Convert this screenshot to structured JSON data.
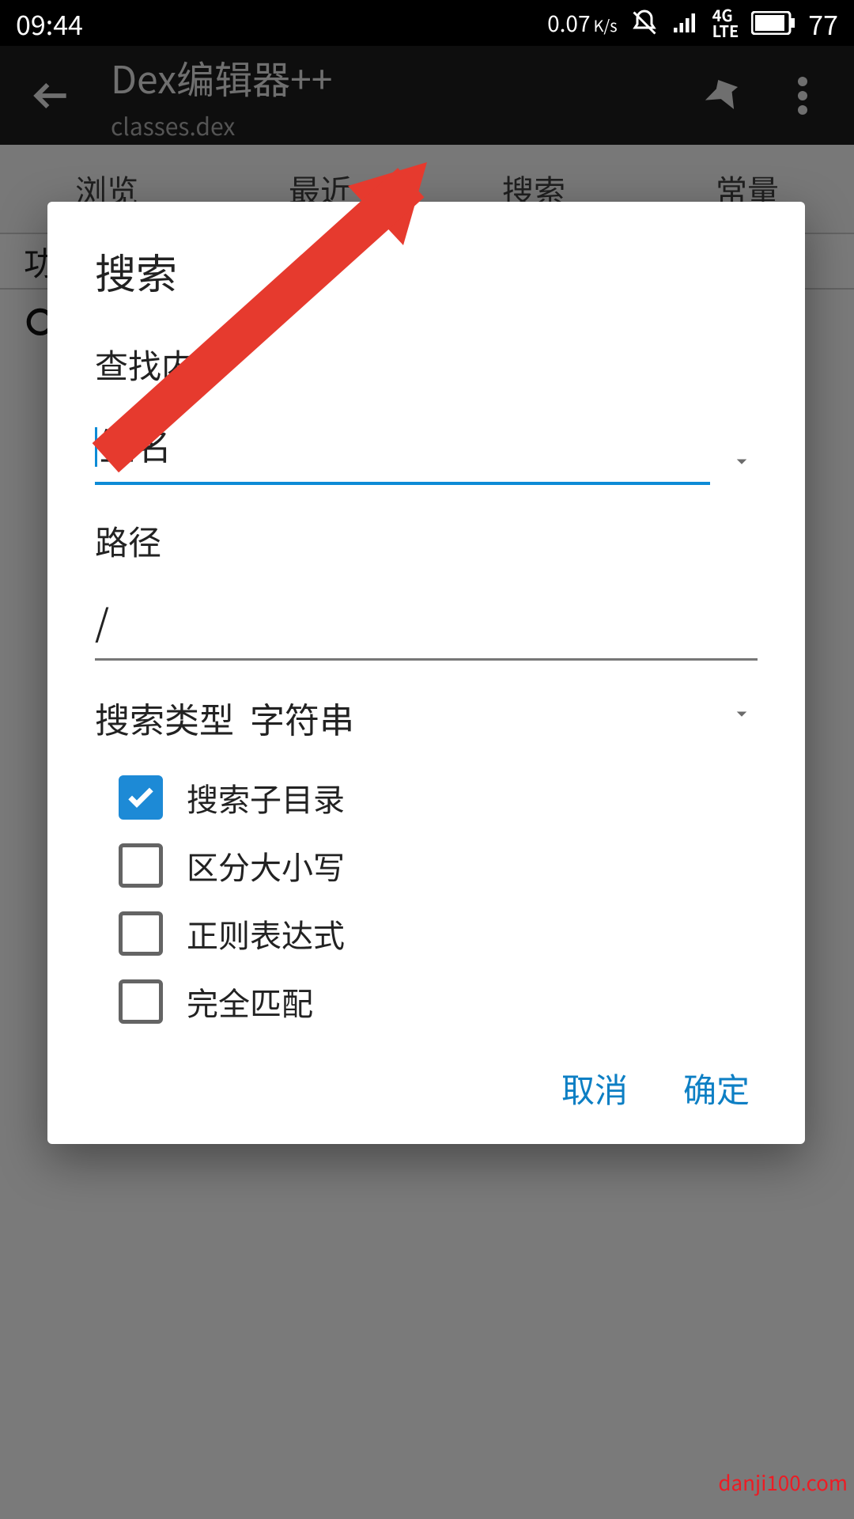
{
  "status": {
    "time": "09:44",
    "speed_value": "0.07",
    "speed_unit": "K/s",
    "network": "4G LTE",
    "battery": "77"
  },
  "appbar": {
    "title": "Dex编辑器++",
    "subtitle": "classes.dex"
  },
  "tabs": [
    "浏览",
    "最近",
    "搜索",
    "常量"
  ],
  "section_heading": "功",
  "dialog": {
    "title": "搜索",
    "find_label": "查找内容",
    "find_value": "签名",
    "path_label": "路径",
    "path_value": "/",
    "type_label": "搜索类型",
    "type_value": "字符串",
    "checks": [
      {
        "label": "搜索子目录",
        "checked": true
      },
      {
        "label": "区分大小写",
        "checked": false
      },
      {
        "label": "正则表达式",
        "checked": false
      },
      {
        "label": "完全匹配",
        "checked": false
      }
    ],
    "cancel": "取消",
    "ok": "确定"
  },
  "watermark": "danji100.com"
}
